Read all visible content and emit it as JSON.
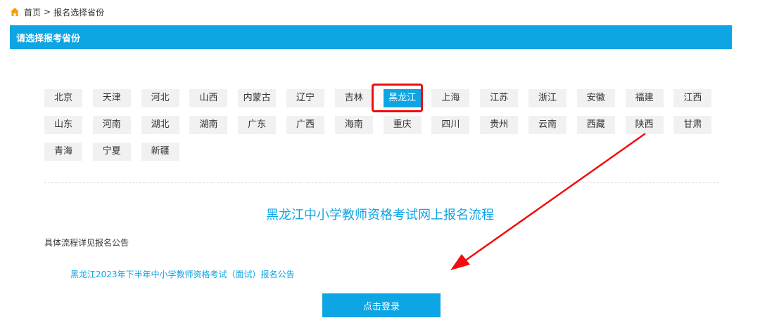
{
  "breadcrumb": {
    "home": "首页",
    "separator": ">",
    "current": "报名选择省份"
  },
  "header": {
    "title": "请选择报考省份"
  },
  "provinces": [
    "北京",
    "天津",
    "河北",
    "山西",
    "内蒙古",
    "辽宁",
    "吉林",
    "黑龙江",
    "上海",
    "江苏",
    "浙江",
    "安徽",
    "福建",
    "江西",
    "山东",
    "河南",
    "湖北",
    "湖南",
    "广东",
    "广西",
    "海南",
    "重庆",
    "四川",
    "贵州",
    "云南",
    "西藏",
    "陕西",
    "甘肃",
    "青海",
    "宁夏",
    "新疆"
  ],
  "selected_province": "黑龙江",
  "process": {
    "title": "黑龙江中小学教师资格考试网上报名流程",
    "note": "具体流程详见报名公告",
    "notice_link": "黑龙江2023年下半年中小学教师资格考试（面试）报名公告",
    "login_button": "点击登录"
  },
  "colors": {
    "accent": "#0ea5e4",
    "highlight": "#f20d0d",
    "home_icon": "#f5a100"
  }
}
